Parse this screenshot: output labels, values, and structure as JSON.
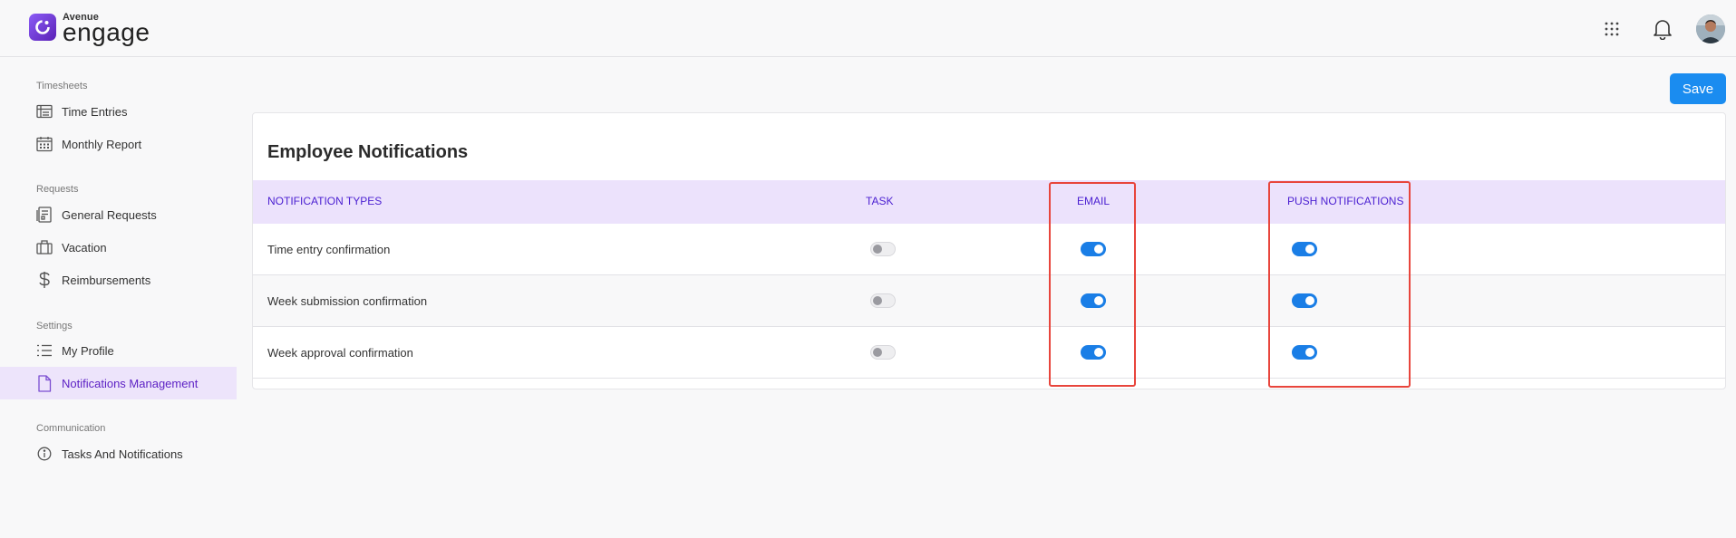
{
  "brand": {
    "small": "Avenue",
    "big": "engage"
  },
  "header": {
    "icons": [
      "apps-grid-icon",
      "bell-icon",
      "user-avatar"
    ]
  },
  "sidebar": {
    "sections": [
      {
        "label": "Timesheets",
        "items": [
          {
            "label": "Time Entries",
            "icon": "time-entries-icon"
          },
          {
            "label": "Monthly Report",
            "icon": "calendar-icon"
          }
        ]
      },
      {
        "label": "Requests",
        "items": [
          {
            "label": "General Requests",
            "icon": "form-icon"
          },
          {
            "label": "Vacation",
            "icon": "luggage-icon"
          },
          {
            "label": "Reimbursements",
            "icon": "dollar-icon"
          }
        ]
      },
      {
        "label": "Settings",
        "items": [
          {
            "label": "My Profile",
            "icon": "list-icon"
          },
          {
            "label": "Notifications Management",
            "icon": "document-icon",
            "active": true
          }
        ]
      },
      {
        "label": "Communication",
        "items": [
          {
            "label": "Tasks And Notifications",
            "icon": "info-icon"
          }
        ]
      }
    ]
  },
  "toolbar": {
    "save_label": "Save"
  },
  "card": {
    "title": "Employee Notifications",
    "columns": [
      "NOTIFICATION TYPES",
      "TASK",
      "EMAIL",
      "PUSH NOTIFICATIONS"
    ],
    "rows": [
      {
        "label": "Time entry confirmation",
        "task": false,
        "email": true,
        "push": true
      },
      {
        "label": "Week submission confirmation",
        "task": false,
        "email": true,
        "push": true
      },
      {
        "label": "Week approval confirmation",
        "task": false,
        "email": true,
        "push": true
      }
    ]
  },
  "colors": {
    "accent": "#1a8cf0",
    "brand": "#6d28d9",
    "active_bg": "#ede4fb",
    "header_row": "#ece2fc",
    "highlight": "#e8453c"
  }
}
